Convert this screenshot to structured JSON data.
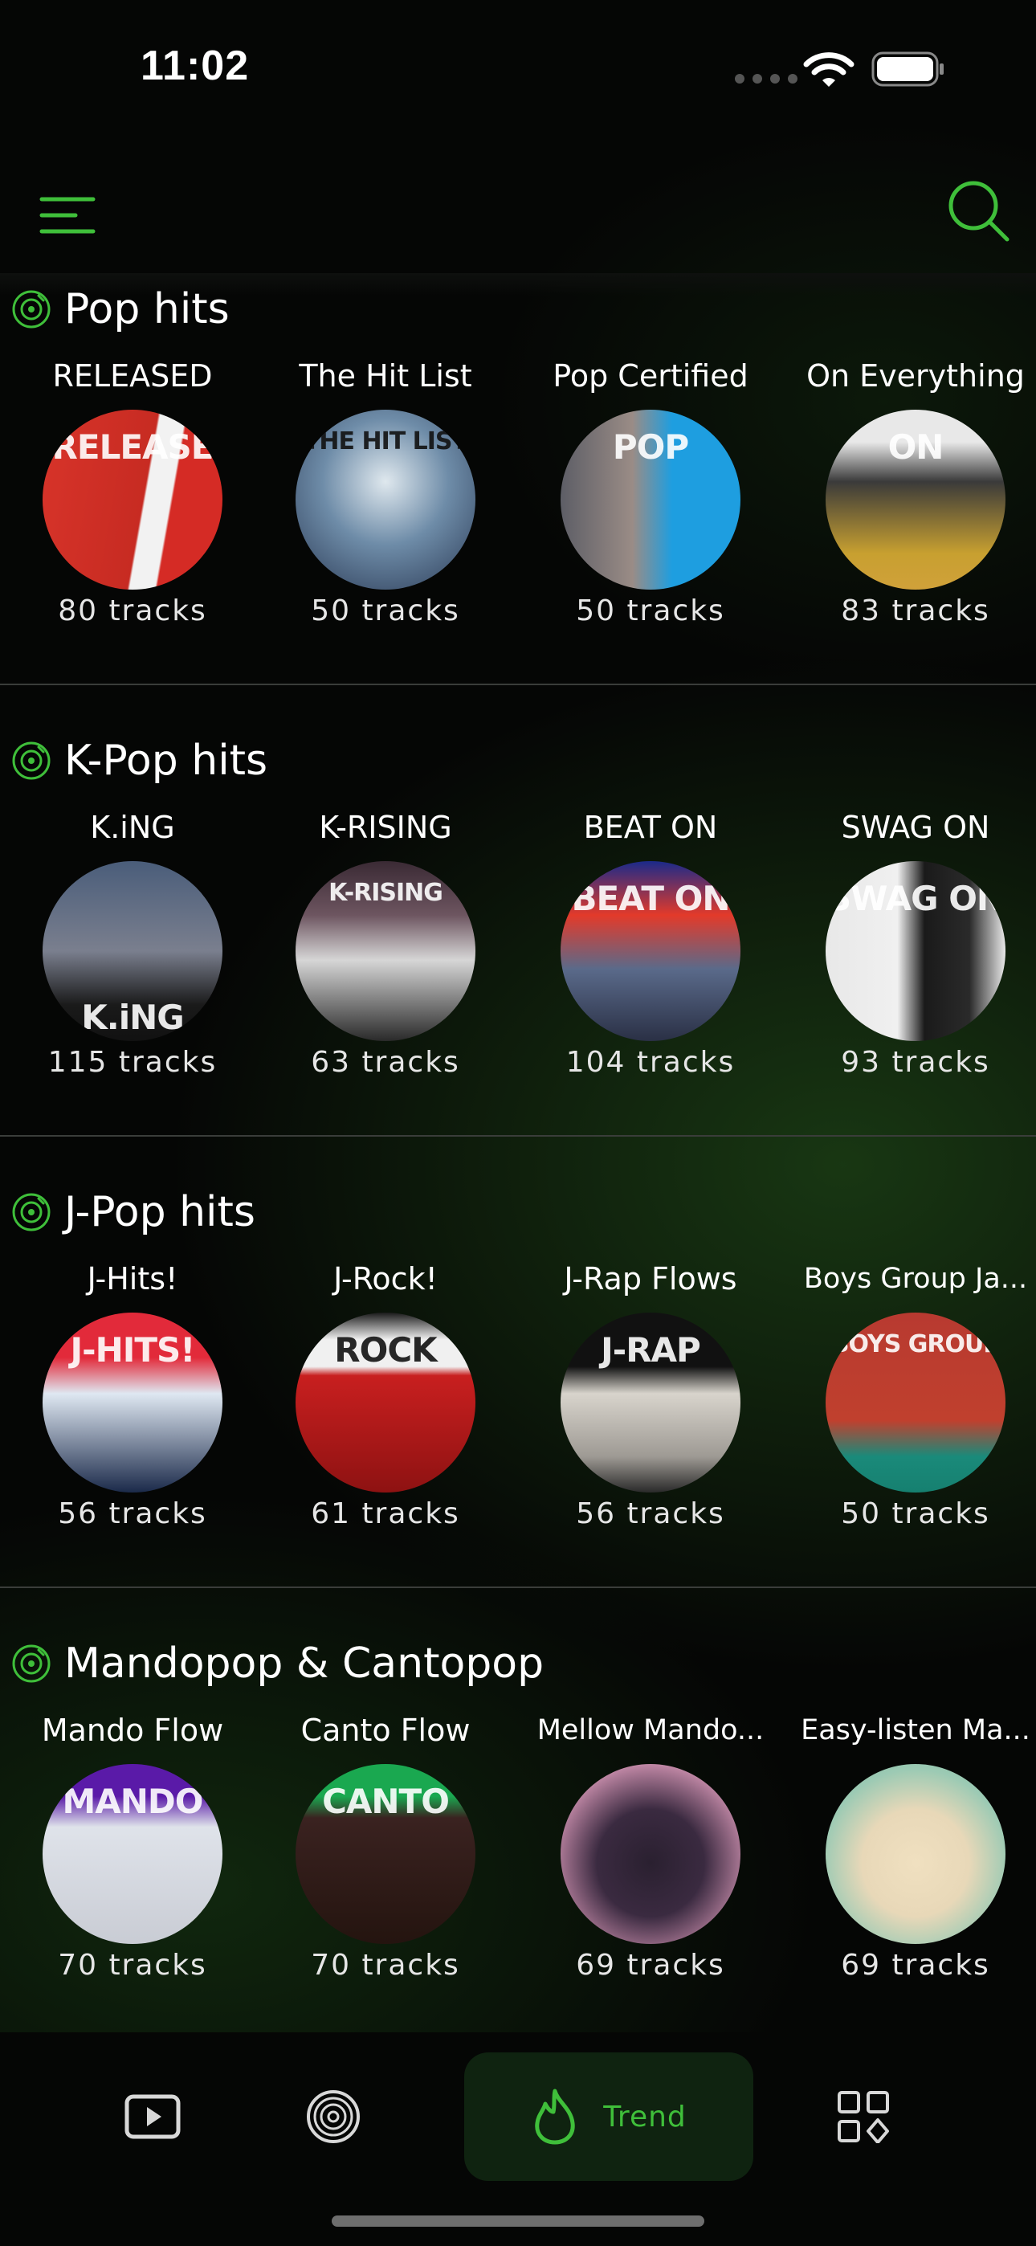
{
  "status_bar": {
    "time": "11:02"
  },
  "colors": {
    "accent": "#3fbf3a",
    "background": "#050605"
  },
  "icons": {
    "menu": "menu-lines-icon",
    "search": "search-icon",
    "section": "vinyl-disc-icon",
    "tab_video": "play-icon",
    "tab_disc": "disc-icon",
    "tab_trend": "flame-icon",
    "tab_more": "grid-shapes-icon"
  },
  "sections": [
    {
      "title": "Pop hits",
      "playlists": [
        {
          "name": "RELEASED",
          "count": "80 tracks"
        },
        {
          "name": "The Hit List",
          "count": "50 tracks"
        },
        {
          "name": "Pop Certified",
          "count": "50 tracks"
        },
        {
          "name": "On Everything",
          "count": "83 tracks"
        }
      ]
    },
    {
      "title": "K-Pop hits",
      "playlists": [
        {
          "name": "K.iNG",
          "count": "115 tracks"
        },
        {
          "name": "K-RISING",
          "count": "63 tracks"
        },
        {
          "name": "BEAT ON",
          "count": "104 tracks"
        },
        {
          "name": "SWAG ON",
          "count": "93 tracks"
        }
      ]
    },
    {
      "title": "J-Pop hits",
      "playlists": [
        {
          "name": "J-Hits!",
          "count": "56 tracks"
        },
        {
          "name": "J-Rock!",
          "count": "61 tracks"
        },
        {
          "name": "J-Rap Flows",
          "count": "56 tracks"
        },
        {
          "name": "Boys Group Ja...",
          "count": "50 tracks"
        }
      ]
    },
    {
      "title": "Mandopop & Cantopop",
      "playlists": [
        {
          "name": "Mando Flow",
          "count": "70 tracks"
        },
        {
          "name": "Canto Flow",
          "count": "70 tracks"
        },
        {
          "name": "Mellow Mando...",
          "count": "69 tracks"
        },
        {
          "name": "Easy-listen Ma...",
          "count": "69 tracks"
        }
      ]
    }
  ],
  "bottom_nav": {
    "trend_label": "Trend"
  }
}
